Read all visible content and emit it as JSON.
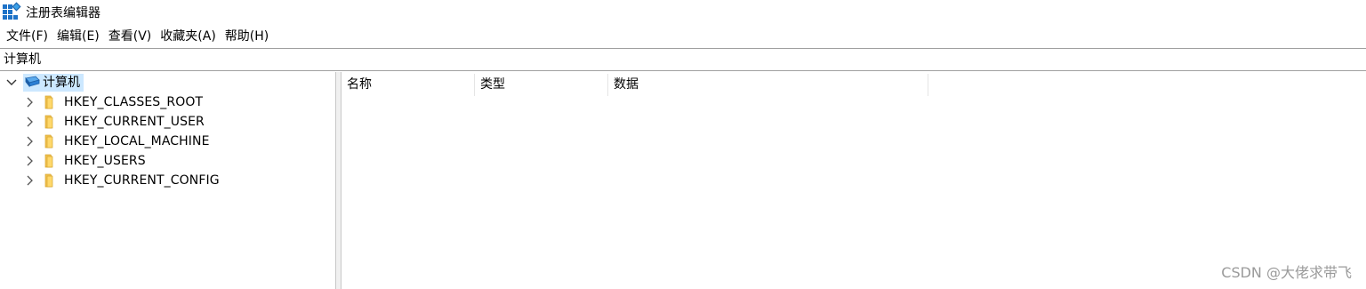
{
  "window": {
    "title": "注册表编辑器"
  },
  "menu": {
    "items": [
      "文件(F)",
      "编辑(E)",
      "查看(V)",
      "收藏夹(A)",
      "帮助(H)"
    ]
  },
  "address": {
    "path": "计算机"
  },
  "tree": {
    "root": {
      "label": "计算机",
      "icon": "computer-icon",
      "expanded": true,
      "selected": true
    },
    "nodes": [
      {
        "label": "HKEY_CLASSES_ROOT",
        "icon": "folder-icon"
      },
      {
        "label": "HKEY_CURRENT_USER",
        "icon": "folder-icon"
      },
      {
        "label": "HKEY_LOCAL_MACHINE",
        "icon": "folder-icon"
      },
      {
        "label": "HKEY_USERS",
        "icon": "folder-icon"
      },
      {
        "label": "HKEY_CURRENT_CONFIG",
        "icon": "folder-icon"
      }
    ]
  },
  "list": {
    "columns": [
      "名称",
      "类型",
      "数据"
    ]
  },
  "watermark": "CSDN @大佬求带飞",
  "colors": {
    "selection": "#cce8ff",
    "folder": "#f3c34f",
    "computer": "#2b7fd4"
  }
}
